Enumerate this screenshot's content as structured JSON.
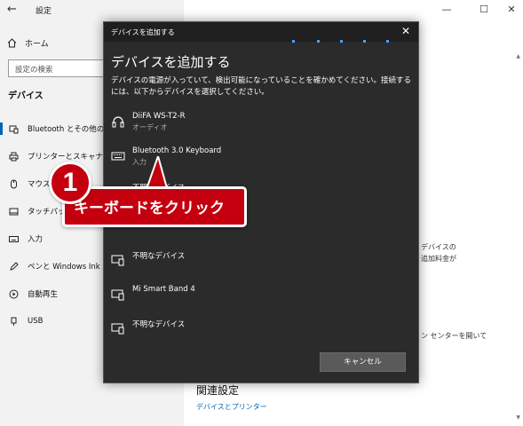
{
  "settings": {
    "title": "設定",
    "window_controls": {
      "minimize": "—",
      "maximize": "☐",
      "close": "✕"
    },
    "home_label": "ホーム",
    "search_placeholder": "設定の検索",
    "section": "デバイス",
    "nav_items": [
      {
        "label": "Bluetooth とその他のデ",
        "icon": "bluetooth-devices-icon"
      },
      {
        "label": "プリンターとスキャナー",
        "icon": "printer-icon"
      },
      {
        "label": "マウス",
        "icon": "mouse-icon"
      },
      {
        "label": "タッチパッド",
        "icon": "touchpad-icon"
      },
      {
        "label": "入力",
        "icon": "keyboard-icon"
      },
      {
        "label": "ペンと Windows Ink",
        "icon": "pen-icon"
      },
      {
        "label": "自動再生",
        "icon": "autoplay-icon"
      },
      {
        "label": "USB",
        "icon": "usb-icon"
      }
    ],
    "right_snippets": {
      "line1": "デバイスの",
      "line2": "追加料金が",
      "line3": "ン センターを開いて"
    },
    "related_heading": "関連設定",
    "related_link": "デバイスとプリンター"
  },
  "dialog": {
    "title": "デバイスを追加する",
    "heading": "デバイスを追加する",
    "description": "デバイスの電源が入っていて、検出可能になっていることを確かめてください。接続するには、以下からデバイスを選択してください。",
    "devices": [
      {
        "name": "DiiFA WS-T2-R",
        "type": "オーディオ",
        "icon": "headset-icon"
      },
      {
        "name": "Bluetooth 3.0 Keyboard",
        "type": "入力",
        "icon": "keyboard-icon"
      },
      {
        "name": "不明なデバイス",
        "type": "",
        "icon": "unknown-device-icon"
      },
      {
        "name": "不明なデバイス",
        "type": "",
        "icon": "unknown-device-icon"
      },
      {
        "name": "Mi Smart Band 4",
        "type": "",
        "icon": "unknown-device-icon"
      },
      {
        "name": "不明なデバイス",
        "type": "",
        "icon": "unknown-device-icon"
      }
    ],
    "cancel_label": "キャンセル"
  },
  "annotation": {
    "step_number": "1",
    "callout_text": "キーボードをクリック",
    "color": "#c4000f"
  }
}
